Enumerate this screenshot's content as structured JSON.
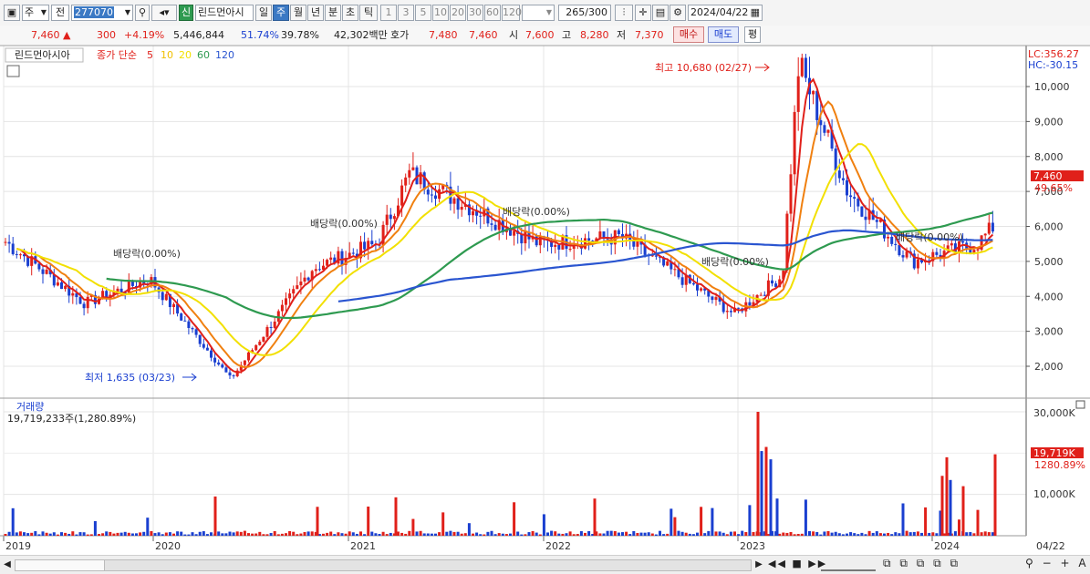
{
  "toolbar": {
    "market_label": "주",
    "prev_label": "전",
    "code": "277070",
    "new_badge": "신",
    "stock_name": "린드먼아시",
    "periods": [
      "일",
      "주",
      "월",
      "년",
      "분",
      "초",
      "틱"
    ],
    "selected_period": "주",
    "intervals": [
      "1",
      "3",
      "5",
      "10",
      "20",
      "30",
      "60",
      "120"
    ],
    "count_value": "265",
    "count_max": "/300",
    "date": "2024/04/22"
  },
  "infobar": {
    "price": "7,460",
    "change": "300",
    "change_rate": "+4.19%",
    "volume": "5,446,844",
    "ratio1": "51.74%",
    "ratio2": "39.78%",
    "amount": "42,302백만",
    "ask_label": "호가",
    "ask1": "7,480",
    "ask2": "7,460",
    "open_label": "시",
    "open": "7,600",
    "high_label": "고",
    "high": "8,280",
    "low_label": "저",
    "low": "7,370",
    "buy_label": "매수",
    "sell_label": "매도",
    "avg_label": "평"
  },
  "chart": {
    "legend_name": "린드먼아시아",
    "legend_ma_label": "종가 단순",
    "ma_periods": [
      "5",
      "10",
      "20",
      "60",
      "120"
    ],
    "ma_colors": [
      "#e0201a",
      "#f0c000",
      "#f2e000",
      "#2e9a50",
      "#2a55d0"
    ],
    "lc_label": "LC:356.27",
    "hc_label": "HC:-30.15",
    "high_annotation": "최고 10,680 (02/27)",
    "low_annotation": "최저 1,635 (03/23)",
    "dividend_label": "배당락(0.00%)",
    "current_price_tag": "7,460",
    "current_pct_tag": "49.65%",
    "price_ticks": [
      "10,000",
      "9,000",
      "8,000",
      "7,000",
      "6,000",
      "5,000",
      "4,000",
      "3,000",
      "2,000"
    ],
    "volume_title": "거래량",
    "volume_value": "19,719,233주(1,280.89%)",
    "volume_ticks": [
      "30,000K",
      "10,000K"
    ],
    "volume_tag": "19,719K",
    "volume_pct_tag": "1280.89%",
    "x_labels": [
      "2019",
      "2020",
      "2021",
      "2022",
      "2023",
      "2024"
    ],
    "x_end_label": "04/22"
  },
  "chart_data": {
    "type": "candlestick",
    "interval": "weekly",
    "y_range": [
      1500,
      10800
    ],
    "milestones": [
      {
        "date": "2019-01",
        "price": 5600
      },
      {
        "date": "2019-06",
        "price": 3800
      },
      {
        "date": "2019-10",
        "price": 4500
      },
      {
        "date": "2020-03",
        "price": 1635
      },
      {
        "date": "2020-08",
        "price": 4800
      },
      {
        "date": "2020-12",
        "price": 5500
      },
      {
        "date": "2021-02",
        "price": 7500
      },
      {
        "date": "2021-06",
        "price": 6500
      },
      {
        "date": "2021-10",
        "price": 5500
      },
      {
        "date": "2022-03",
        "price": 5700
      },
      {
        "date": "2022-10",
        "price": 3500
      },
      {
        "date": "2023-01",
        "price": 4600
      },
      {
        "date": "2023-02",
        "price": 10680
      },
      {
        "date": "2023-05",
        "price": 7000
      },
      {
        "date": "2023-09",
        "price": 5000
      },
      {
        "date": "2024-01",
        "price": 5500
      },
      {
        "date": "2024-03",
        "price": 6500
      },
      {
        "date": "2024-04",
        "price": 7460
      }
    ],
    "volume_peak_k": 30000,
    "current_volume_k": 19719
  }
}
